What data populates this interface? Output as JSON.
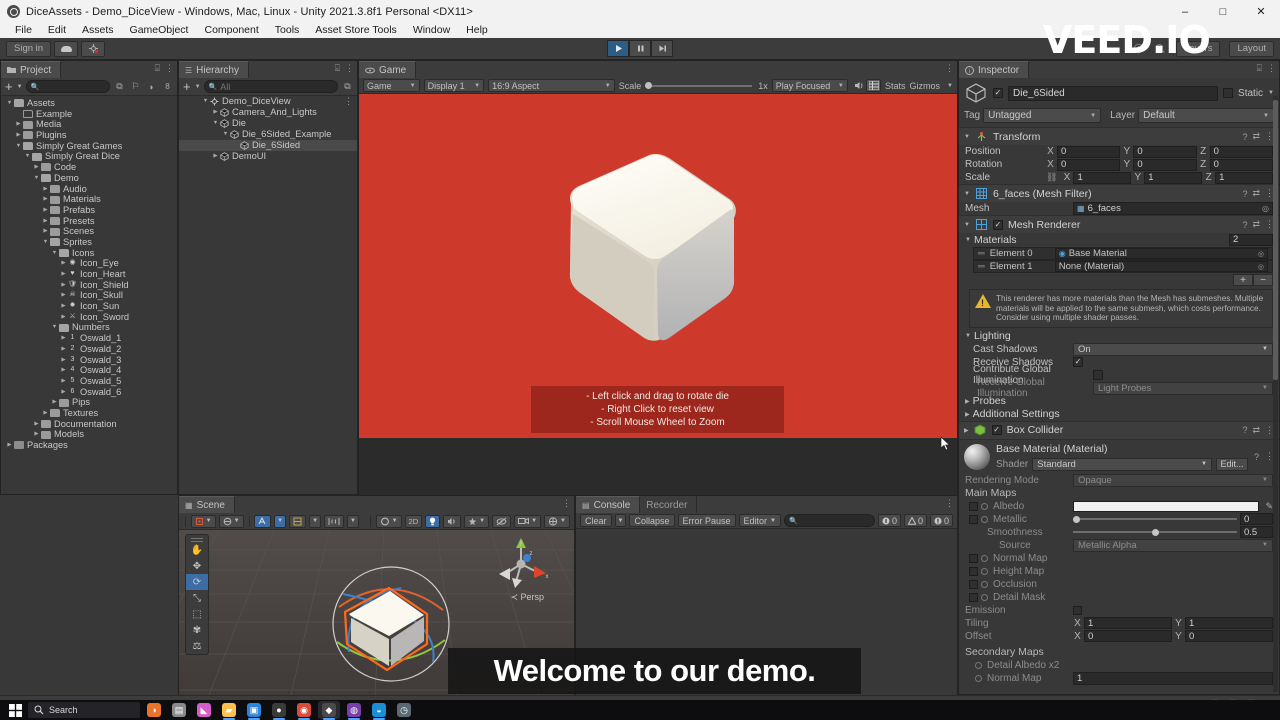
{
  "window": {
    "title": "DiceAssets - Demo_DiceView - Windows, Mac, Linux - Unity 2021.3.8f1 Personal <DX11>",
    "minimize": "–",
    "maximize": "□",
    "close": "✕"
  },
  "menubar": {
    "items": [
      "File",
      "Edit",
      "Assets",
      "GameObject",
      "Component",
      "Tools",
      "Asset Store Tools",
      "Window",
      "Help"
    ]
  },
  "toolbar": {
    "signin": "Sign in",
    "cloud_icon": "cloud-icon",
    "account_icon": "account-icon",
    "play": "play-icon",
    "pause": "pause-icon",
    "step": "step-icon",
    "layers_label": "Layers",
    "layout_label": "Layout"
  },
  "project": {
    "tab": "Project",
    "search_placeholder": "",
    "badge": "8",
    "tree": [
      {
        "label": "Assets",
        "depth": 0,
        "arrow": "▼",
        "icon": "folder-open",
        "sel": false
      },
      {
        "label": "Example",
        "depth": 1,
        "arrow": "",
        "icon": "folder-hollow",
        "sel": false
      },
      {
        "label": "Media",
        "depth": 1,
        "arrow": "▶",
        "icon": "folder",
        "sel": false
      },
      {
        "label": "Plugins",
        "depth": 1,
        "arrow": "▶",
        "icon": "folder",
        "sel": false
      },
      {
        "label": "Simply Great Games",
        "depth": 1,
        "arrow": "▼",
        "icon": "folder-open",
        "sel": false
      },
      {
        "label": "Simply Great Dice",
        "depth": 2,
        "arrow": "▼",
        "icon": "folder-open",
        "sel": false
      },
      {
        "label": "Code",
        "depth": 3,
        "arrow": "▶",
        "icon": "folder",
        "sel": false
      },
      {
        "label": "Demo",
        "depth": 3,
        "arrow": "▼",
        "icon": "folder-open",
        "sel": false
      },
      {
        "label": "Audio",
        "depth": 4,
        "arrow": "▶",
        "icon": "folder",
        "sel": false
      },
      {
        "label": "Materials",
        "depth": 4,
        "arrow": "▶",
        "icon": "folder",
        "sel": false
      },
      {
        "label": "Prefabs",
        "depth": 4,
        "arrow": "▶",
        "icon": "folder",
        "sel": false
      },
      {
        "label": "Presets",
        "depth": 4,
        "arrow": "▶",
        "icon": "folder",
        "sel": false
      },
      {
        "label": "Scenes",
        "depth": 4,
        "arrow": "▶",
        "icon": "folder",
        "sel": false
      },
      {
        "label": "Sprites",
        "depth": 4,
        "arrow": "▼",
        "icon": "folder-open",
        "sel": false
      },
      {
        "label": "Icons",
        "depth": 5,
        "arrow": "▼",
        "icon": "folder-open",
        "sel": false
      },
      {
        "label": "Icon_Eye",
        "depth": 6,
        "arrow": "▶",
        "icon": "sprite-eye",
        "sel": false
      },
      {
        "label": "Icon_Heart",
        "depth": 6,
        "arrow": "▶",
        "icon": "sprite-heart",
        "sel": false
      },
      {
        "label": "Icon_Shield",
        "depth": 6,
        "arrow": "▶",
        "icon": "sprite-shield",
        "sel": false
      },
      {
        "label": "Icon_Skull",
        "depth": 6,
        "arrow": "▶",
        "icon": "sprite-skull",
        "sel": false
      },
      {
        "label": "Icon_Sun",
        "depth": 6,
        "arrow": "▶",
        "icon": "sprite-sun",
        "sel": false
      },
      {
        "label": "Icon_Sword",
        "depth": 6,
        "arrow": "▶",
        "icon": "sprite-sword",
        "sel": false
      },
      {
        "label": "Numbers",
        "depth": 5,
        "arrow": "▼",
        "icon": "folder-open",
        "sel": false
      },
      {
        "label": "Oswald_1",
        "depth": 6,
        "arrow": "▶",
        "icon": "sprite-1",
        "sel": false
      },
      {
        "label": "Oswald_2",
        "depth": 6,
        "arrow": "▶",
        "icon": "sprite-2",
        "sel": false
      },
      {
        "label": "Oswald_3",
        "depth": 6,
        "arrow": "▶",
        "icon": "sprite-3",
        "sel": false
      },
      {
        "label": "Oswald_4",
        "depth": 6,
        "arrow": "▶",
        "icon": "sprite-4",
        "sel": false
      },
      {
        "label": "Oswald_5",
        "depth": 6,
        "arrow": "▶",
        "icon": "sprite-5",
        "sel": false
      },
      {
        "label": "Oswald_6",
        "depth": 6,
        "arrow": "▶",
        "icon": "sprite-6",
        "sel": false
      },
      {
        "label": "Pips",
        "depth": 5,
        "arrow": "▶",
        "icon": "folder",
        "sel": false
      },
      {
        "label": "Textures",
        "depth": 4,
        "arrow": "▶",
        "icon": "folder",
        "sel": false
      },
      {
        "label": "Documentation",
        "depth": 3,
        "arrow": "▶",
        "icon": "folder",
        "sel": false
      },
      {
        "label": "Models",
        "depth": 3,
        "arrow": "▶",
        "icon": "folder",
        "sel": false
      },
      {
        "label": "Packages",
        "depth": 0,
        "arrow": "▶",
        "icon": "package",
        "sel": false
      }
    ]
  },
  "hierarchy": {
    "tab": "Hierarchy",
    "search_placeholder": "All",
    "rows": [
      {
        "label": "Demo_DiceView",
        "depth": 0,
        "arrow": "▼",
        "icon": "scene-icon",
        "sel": false
      },
      {
        "label": "Camera_And_Lights",
        "depth": 1,
        "arrow": "▶",
        "icon": "cube-icon",
        "sel": false
      },
      {
        "label": "Die",
        "depth": 1,
        "arrow": "▼",
        "icon": "cube-icon",
        "sel": false
      },
      {
        "label": "Die_6Sided_Example",
        "depth": 2,
        "arrow": "▼",
        "icon": "cube-icon",
        "sel": false
      },
      {
        "label": "Die_6Sided",
        "depth": 3,
        "arrow": "",
        "icon": "cube-icon",
        "sel": true
      },
      {
        "label": "DemoUI",
        "depth": 1,
        "arrow": "▶",
        "icon": "cube-icon",
        "sel": false
      }
    ]
  },
  "game": {
    "tab": "Game",
    "view_mode": "Game",
    "display": "Display 1",
    "aspect": "16:9 Aspect",
    "scale_label": "Scale",
    "scale_value": "1x",
    "play_mode": "Play Focused",
    "mute_icon": "mute-audio-icon",
    "stats": "Stats",
    "gizmos": "Gizmos",
    "background_color": "#cd3a2c",
    "hints": [
      "- Left click and drag to rotate die",
      "- Right Click to reset view",
      "- Scroll Mouse Wheel to Zoom"
    ]
  },
  "inspector": {
    "tab": "Inspector",
    "object_name": "Die_6Sided",
    "static_label": "Static",
    "tag_label": "Tag",
    "tag_value": "Untagged",
    "layer_label": "Layer",
    "layer_value": "Default",
    "transform": {
      "title": "Transform",
      "rows": [
        {
          "label": "Position",
          "x": "0",
          "y": "0",
          "z": "0"
        },
        {
          "label": "Rotation",
          "x": "0",
          "y": "0",
          "z": "0"
        },
        {
          "label": "Scale",
          "x": "1",
          "y": "1",
          "z": "1"
        }
      ]
    },
    "mesh_filter": {
      "title": "6_faces (Mesh Filter)",
      "mesh_label": "Mesh",
      "mesh_value": "6_faces"
    },
    "mesh_renderer": {
      "title": "Mesh Renderer",
      "materials_label": "Materials",
      "materials_count": "2",
      "elements": [
        {
          "label": "Element 0",
          "value": "Base Material"
        },
        {
          "label": "Element 1",
          "value": "None (Material)"
        }
      ],
      "add_btn": "+",
      "remove_btn": "−",
      "warning": "This renderer has more materials than the Mesh has submeshes. Multiple materials will be applied to the same submesh, which costs performance. Consider using multiple shader passes.",
      "lighting_label": "Lighting",
      "cast_shadows_label": "Cast Shadows",
      "cast_shadows_value": "On",
      "receive_shadows_label": "Receive Shadows",
      "receive_shadows_checked": true,
      "contribute_gi_label": "Contribute Global Illumination",
      "contribute_gi_checked": false,
      "receive_gi_label": "Receive Global Illumination",
      "receive_gi_value": "Light Probes",
      "probes_label": "Probes",
      "additional_label": "Additional Settings"
    },
    "box_collider": {
      "title": "Box Collider"
    },
    "material": {
      "title": "Base Material (Material)",
      "shader_label": "Shader",
      "shader_value": "Standard",
      "edit_btn": "Edit...",
      "rendering_mode_label": "Rendering Mode",
      "rendering_mode_value": "Opaque",
      "main_maps_label": "Main Maps",
      "albedo_label": "Albedo",
      "albedo_color": "#f1f1f1",
      "metallic_label": "Metallic",
      "metallic_value": "0",
      "smoothness_label": "Smoothness",
      "smoothness_value": "0.5",
      "source_label": "Source",
      "source_value": "Metallic Alpha",
      "normal_map_label": "Normal Map",
      "height_map_label": "Height Map",
      "occlusion_label": "Occlusion",
      "detail_mask_label": "Detail Mask",
      "emission_label": "Emission",
      "tiling_label": "Tiling",
      "tiling_x": "1",
      "tiling_y": "1",
      "offset_label": "Offset",
      "offset_x": "0",
      "offset_y": "0",
      "secondary_maps_label": "Secondary Maps",
      "detail_albedo_label": "Detail Albedo x2",
      "secondary_normal_label": "Normal Map",
      "secondary_normal_value": "1"
    }
  },
  "scene": {
    "tab": "Scene",
    "tools": [
      "hand-tool",
      "move-tool",
      "rotate-tool",
      "scale-tool",
      "rect-tool",
      "transform-tool",
      "custom-tool"
    ],
    "active_tool_index": 2,
    "toolbar": {
      "pivot": "pivot-icon",
      "local": "local-icon",
      "grid": "grid-icon",
      "snap": "snap-icon",
      "layers": "layers-icon",
      "shading": "shading-icon",
      "mode_2d": "2D",
      "lighting": "lighting-icon",
      "audio": "audio-icon",
      "fx": "fx-icon",
      "gizmos_hide": "gizmos-hide-icon",
      "camera": "camera-icon",
      "visibility": "visibility-icon"
    },
    "perspective_label": "Persp",
    "gizmo_axes": [
      "x",
      "y",
      "z"
    ]
  },
  "console": {
    "tab": "Console",
    "tab2": "Recorder",
    "clear": "Clear",
    "collapse": "Collapse",
    "error_pause": "Error Pause",
    "editor": "Editor",
    "search_placeholder": "",
    "counts": {
      "log": "0",
      "warning": "0",
      "error": "0"
    }
  },
  "overlay": {
    "watermark": "VEED.IO",
    "subtitle": "Welcome to our demo."
  },
  "taskbar": {
    "start": "start-icon",
    "search_placeholder": "Search",
    "apps": [
      {
        "name": "widgets-icon",
        "color": "#e8732a",
        "glyph": "◑"
      },
      {
        "name": "taskview-icon",
        "color": "#8a8a8a",
        "glyph": "▤"
      },
      {
        "name": "app-pink-icon",
        "color": "#d65cc8",
        "glyph": "◣"
      },
      {
        "name": "file-explorer-icon",
        "color": "#ffc14d",
        "glyph": "▰"
      },
      {
        "name": "app-blue-icon",
        "color": "#2e84d8",
        "glyph": "▣"
      },
      {
        "name": "app-dark-icon",
        "color": "#3a3a3a",
        "glyph": "●"
      },
      {
        "name": "chrome-icon",
        "color": "#d94c3d",
        "glyph": "◉"
      },
      {
        "name": "unity-icon",
        "color": "#4a4a4a",
        "glyph": "◆"
      },
      {
        "name": "github-icon",
        "color": "#7b3fa8",
        "glyph": "◍"
      },
      {
        "name": "edge-icon",
        "color": "#1b8fd4",
        "glyph": "◒"
      },
      {
        "name": "clock-icon",
        "color": "#5a6a72",
        "glyph": "◷"
      }
    ]
  }
}
